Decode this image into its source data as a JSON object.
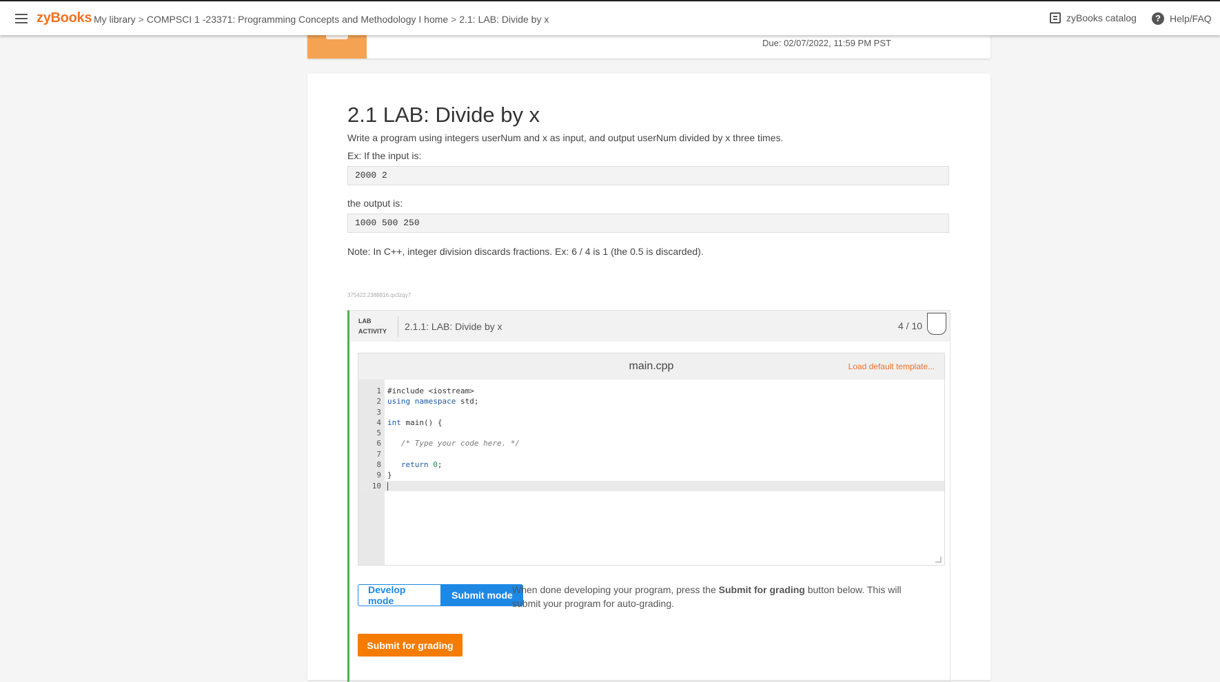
{
  "header": {
    "logo": "zyBooks",
    "breadcrumbs": [
      "My library",
      "COMPSCI 1 -23371: Programming Concepts and Methodology I home",
      "2.1: LAB: Divide by x"
    ],
    "separator": ">",
    "catalog_label": "zyBooks catalog",
    "help_label": "Help/FAQ"
  },
  "prev_section": {
    "due": "Due: 02/07/2022, 11:59 PM PST"
  },
  "section": {
    "title": "2.1 LAB: Divide by x",
    "description": "Write a program using integers userNum and x as input, and output userNum divided by x three times.",
    "example_intro": "Ex: If the input is:",
    "example_input": "2000 2",
    "output_intro": "the output is:",
    "example_output": "1000 500 250",
    "note": "Note: In C++, integer division discards fractions. Ex: 6 / 4 is 1 (the 0.5 is discarded).",
    "tiny_id": "375422.2388816.qx3zqy7"
  },
  "lab": {
    "tag_line1": "LAB",
    "tag_line2": "ACTIVITY",
    "name": "2.1.1: LAB: Divide by x",
    "score": "4 / 10",
    "filename": "main.cpp",
    "load_template": "Load default template...",
    "code_lines": [
      {
        "n": "1",
        "code": "#include <iostream>"
      },
      {
        "n": "2",
        "code": "using namespace std;"
      },
      {
        "n": "3",
        "code": ""
      },
      {
        "n": "4",
        "code": "int main() {"
      },
      {
        "n": "5",
        "code": ""
      },
      {
        "n": "6",
        "code": "   /* Type your code here. */"
      },
      {
        "n": "7",
        "code": ""
      },
      {
        "n": "8",
        "code": "   return 0;"
      },
      {
        "n": "9",
        "code": "}"
      },
      {
        "n": "10",
        "code": ""
      }
    ],
    "develop_mode": "Develop mode",
    "submit_mode": "Submit mode",
    "mode_help_prefix": "When done developing your program, press the ",
    "mode_help_bold": "Submit for grading",
    "mode_help_suffix": " button below. This will submit your program for auto-grading.",
    "submit_button": "Submit for grading"
  }
}
